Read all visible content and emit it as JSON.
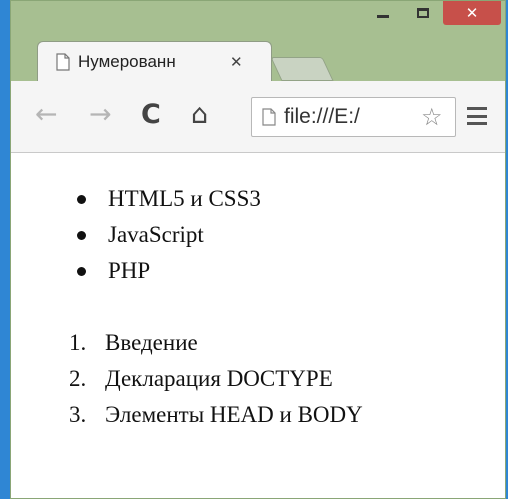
{
  "window": {
    "minimize_icon": "minimize-icon",
    "maximize_icon": "maximize-icon",
    "close_label": "✕"
  },
  "tab": {
    "title": "Нумерованн",
    "close_label": "✕",
    "icon": "page-icon"
  },
  "toolbar": {
    "back_label": "←",
    "forward_label": "→",
    "reload_label": "C",
    "home_label": "⌂",
    "url": "file:///E:/",
    "star_label": "☆",
    "menu_icon": "menu-icon"
  },
  "content": {
    "unordered_list": [
      "HTML5 и CSS3",
      "JavaScript",
      "PHP"
    ],
    "ordered_list": [
      {
        "num": "1.",
        "text": "Введение"
      },
      {
        "num": "2.",
        "text": "Декларация DOCTYPE"
      },
      {
        "num": "3.",
        "text": "Элементы HEAD и BODY"
      }
    ]
  },
  "colors": {
    "desktop": "#2f86d4",
    "frame": "#a7bf91",
    "close_button": "#c7504a",
    "toolbar": "#f5f5f5"
  }
}
